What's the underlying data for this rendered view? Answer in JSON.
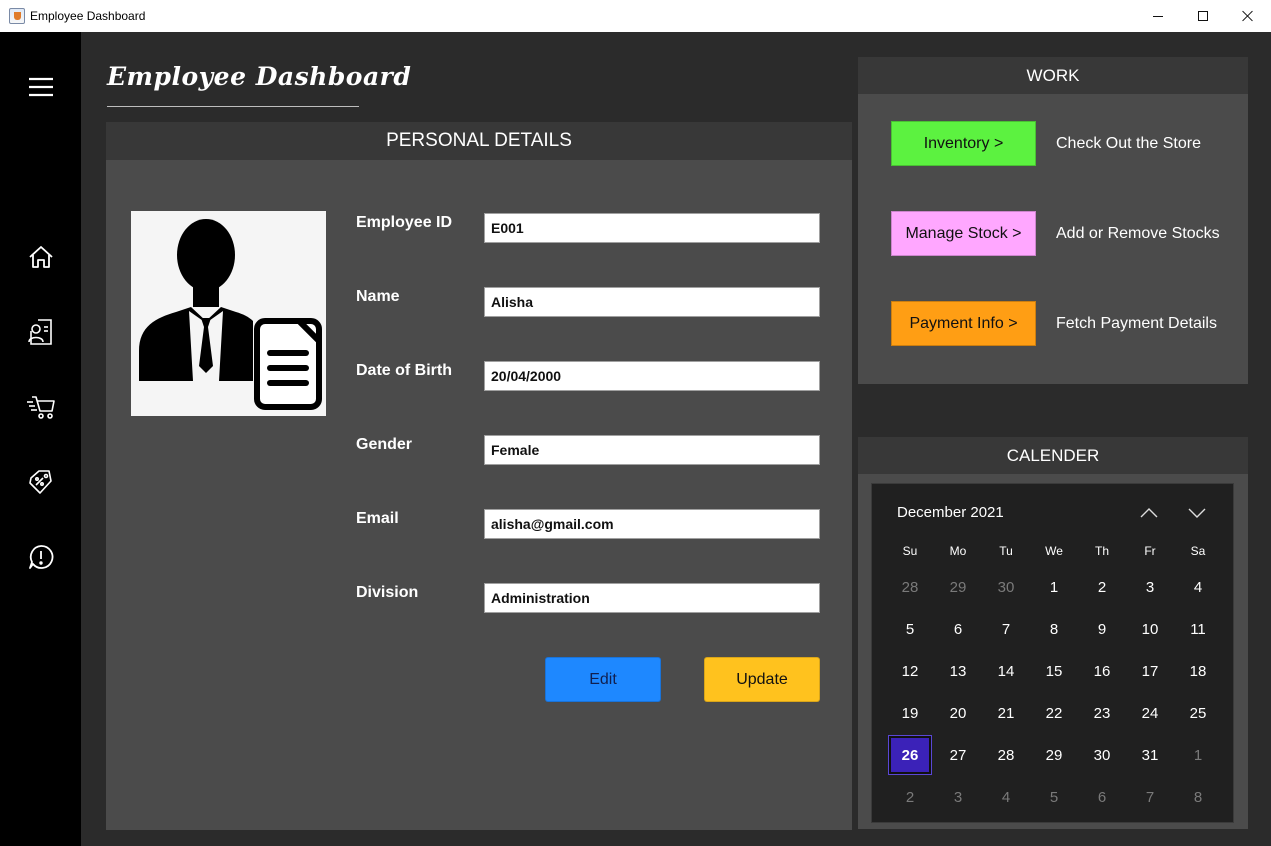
{
  "window": {
    "title": "Employee Dashboard"
  },
  "sidebar": {
    "icons": [
      "menu-icon",
      "home-icon",
      "employee-profile-icon",
      "cart-icon",
      "discount-tag-icon",
      "alert-icon"
    ]
  },
  "header": {
    "title": "Employee Dashboard"
  },
  "personal": {
    "title": "PERSONAL DETAILS",
    "fields": [
      {
        "label": "Employee ID",
        "value": "E001"
      },
      {
        "label": "Name",
        "value": "Alisha"
      },
      {
        "label": "Date of Birth",
        "value": "20/04/2000"
      },
      {
        "label": "Gender",
        "value": "Female"
      },
      {
        "label": "Email",
        "value": "alisha@gmail.com"
      },
      {
        "label": "Division",
        "value": "Administration"
      }
    ],
    "edit_label": "Edit",
    "update_label": "Update"
  },
  "work": {
    "title": "WORK",
    "items": [
      {
        "button": "Inventory  >",
        "description": "Check Out the Store",
        "color": "#5cf240"
      },
      {
        "button": "Manage Stock  >",
        "description": "Add or Remove Stocks",
        "color": "#ffa7ff"
      },
      {
        "button": "Payment Info  >",
        "description": "Fetch Payment Details",
        "color": "#ff9e14"
      }
    ]
  },
  "calendar": {
    "title": "CALENDER",
    "month_label": "December 2021",
    "weekdays": [
      "Su",
      "Mo",
      "Tu",
      "We",
      "Th",
      "Fr",
      "Sa"
    ],
    "weeks": [
      [
        "28",
        "29",
        "30",
        "1",
        "2",
        "3",
        "4"
      ],
      [
        "5",
        "6",
        "7",
        "8",
        "9",
        "10",
        "11"
      ],
      [
        "12",
        "13",
        "14",
        "15",
        "16",
        "17",
        "18"
      ],
      [
        "19",
        "20",
        "21",
        "22",
        "23",
        "24",
        "25"
      ],
      [
        "26",
        "27",
        "28",
        "29",
        "30",
        "31",
        "1"
      ],
      [
        "2",
        "3",
        "4",
        "5",
        "6",
        "7",
        "8"
      ]
    ],
    "selected_day": "26",
    "selected_color": "#3b22b8"
  }
}
